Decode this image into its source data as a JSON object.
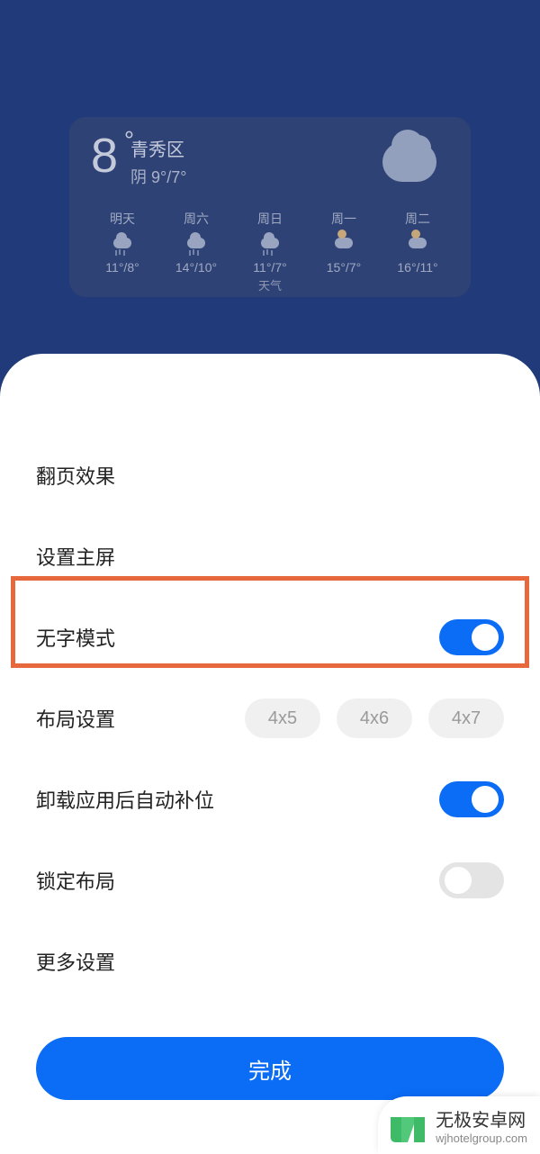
{
  "weather": {
    "temp": "8",
    "location": "青秀区",
    "condition_line": "阴  9°/7°",
    "forecast": [
      {
        "day": "明天",
        "temps": "11°/8°",
        "sub": "",
        "icon": "rain"
      },
      {
        "day": "周六",
        "temps": "14°/10°",
        "sub": "",
        "icon": "rain"
      },
      {
        "day": "周日",
        "temps": "11°/7°",
        "sub": "天气",
        "icon": "rain"
      },
      {
        "day": "周一",
        "temps": "15°/7°",
        "sub": "",
        "icon": "suncloud"
      },
      {
        "day": "周二",
        "temps": "16°/11°",
        "sub": "",
        "icon": "suncloud"
      }
    ]
  },
  "settings": {
    "page_effect": "翻页效果",
    "set_home": "设置主屏",
    "no_text_mode": {
      "label": "无字模式",
      "on": true
    },
    "layout": {
      "label": "布局设置",
      "options": [
        "4x5",
        "4x6",
        "4x7"
      ]
    },
    "auto_fill": {
      "label": "卸载应用后自动补位",
      "on": true
    },
    "lock_layout": {
      "label": "锁定布局",
      "on": false
    },
    "more": "更多设置",
    "done": "完成"
  },
  "watermark": {
    "title": "无极安卓网",
    "url": "wjhotelgroup.com"
  }
}
